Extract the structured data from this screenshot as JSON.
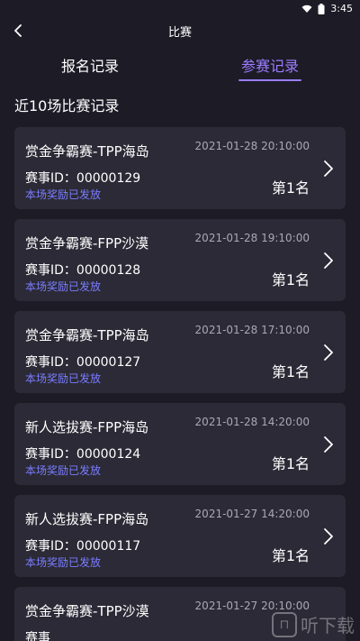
{
  "statusbar": {
    "time": "3:45"
  },
  "navbar": {
    "title": "比赛"
  },
  "tabs": [
    {
      "label": "报名记录",
      "active": false
    },
    {
      "label": "参赛记录",
      "active": true
    }
  ],
  "section_title": "近10场比赛记录",
  "records": [
    {
      "name": "赏金争霸赛-TPP海岛",
      "time": "2021-01-28 20:10:00",
      "id_label": "赛事ID：00000129",
      "status": "本场奖励已发放",
      "rank": "第1名"
    },
    {
      "name": "赏金争霸赛-FPP沙漠",
      "time": "2021-01-28 19:10:00",
      "id_label": "赛事ID：00000128",
      "status": "本场奖励已发放",
      "rank": "第1名"
    },
    {
      "name": "赏金争霸赛-TPP海岛",
      "time": "2021-01-28 17:10:00",
      "id_label": "赛事ID：00000127",
      "status": "本场奖励已发放",
      "rank": "第1名"
    },
    {
      "name": "新人选拔赛-FPP海岛",
      "time": "2021-01-28 14:20:00",
      "id_label": "赛事ID：00000124",
      "status": "本场奖励已发放",
      "rank": "第1名"
    },
    {
      "name": "新人选拔赛-FPP海岛",
      "time": "2021-01-27 14:20:00",
      "id_label": "赛事ID：00000117",
      "status": "本场奖励已发放",
      "rank": "第1名"
    },
    {
      "name": "赏金争霸赛-TPP沙漠",
      "time": "2021-01-27 20:10:00",
      "id_label": "赛事",
      "status": "",
      "rank": ""
    }
  ],
  "watermark": {
    "text": "听下载"
  },
  "colors": {
    "accent": "#9b7cff",
    "status": "#7b7dff",
    "card": "#2b2a36",
    "background": "#1c1b26"
  }
}
